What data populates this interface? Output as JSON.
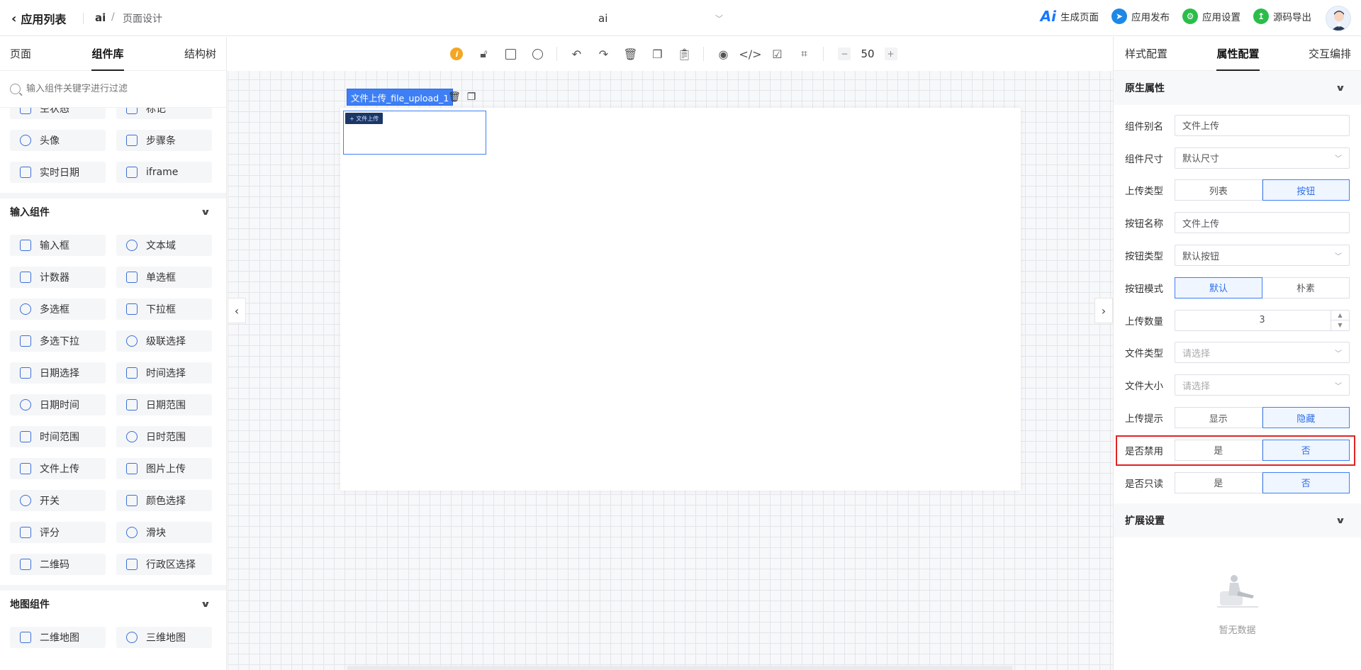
{
  "header": {
    "back_label": "应用列表",
    "app_name": "ai",
    "separator": "/",
    "page_label": "页面设计",
    "current_page": "ai",
    "actions": [
      {
        "label": "生成页面"
      },
      {
        "label": "应用发布"
      },
      {
        "label": "应用设置"
      },
      {
        "label": "源码导出"
      }
    ]
  },
  "left": {
    "tabs": [
      "页面",
      "组件库",
      "结构树"
    ],
    "active_tab": "组件库",
    "search_placeholder": "输入组件关键字进行过滤",
    "clipped_items": [
      "空状态",
      "标记"
    ],
    "top_items": [
      "头像",
      "步骤条",
      "实时日期",
      "iframe"
    ],
    "sections": [
      {
        "title": "输入组件",
        "items": [
          "输入框",
          "文本域",
          "计数器",
          "单选框",
          "多选框",
          "下拉框",
          "多选下拉",
          "级联选择",
          "日期选择",
          "时间选择",
          "日期时间",
          "日期范围",
          "时间范围",
          "日时范围",
          "文件上传",
          "图片上传",
          "开关",
          "颜色选择",
          "评分",
          "滑块",
          "二维码",
          "行政区选择"
        ]
      },
      {
        "title": "地图组件",
        "items": [
          "二维地图",
          "三维地图"
        ]
      }
    ]
  },
  "canvas": {
    "zoom_minus": "−",
    "zoom_value": "50",
    "zoom_plus": "+",
    "selected_label": "文件上传_file_upload_1",
    "upload_button_text": "+ 文件上传"
  },
  "right": {
    "tabs": [
      "样式配置",
      "属性配置",
      "交互编排"
    ],
    "active_tab": "属性配置",
    "section_native": "原生属性",
    "section_extend": "扩展设置",
    "empty_text": "暂无数据",
    "props": {
      "alias": {
        "label": "组件别名",
        "value": "文件上传"
      },
      "size": {
        "label": "组件尺寸",
        "value": "默认尺寸"
      },
      "upload_type": {
        "label": "上传类型",
        "options": [
          "列表",
          "按钮"
        ],
        "selected": "按钮"
      },
      "button_name": {
        "label": "按钮名称",
        "value": "文件上传"
      },
      "button_type": {
        "label": "按钮类型",
        "value": "默认按钮"
      },
      "button_mode": {
        "label": "按钮模式",
        "options": [
          "默认",
          "朴素"
        ],
        "selected": "默认"
      },
      "upload_count": {
        "label": "上传数量",
        "value": "3"
      },
      "file_type": {
        "label": "文件类型",
        "placeholder": "请选择"
      },
      "file_size": {
        "label": "文件大小",
        "placeholder": "请选择"
      },
      "upload_tip": {
        "label": "上传提示",
        "options": [
          "显示",
          "隐藏"
        ],
        "selected": "隐藏"
      },
      "disabled": {
        "label": "是否禁用",
        "options": [
          "是",
          "否"
        ],
        "selected": "否"
      },
      "readonly": {
        "label": "是否只读",
        "options": [
          "是",
          "否"
        ],
        "selected": "否"
      }
    }
  },
  "colors": {
    "accent": "#3e7ff5",
    "highlight_border": "#e02424",
    "info_icon": "#f5a623"
  }
}
